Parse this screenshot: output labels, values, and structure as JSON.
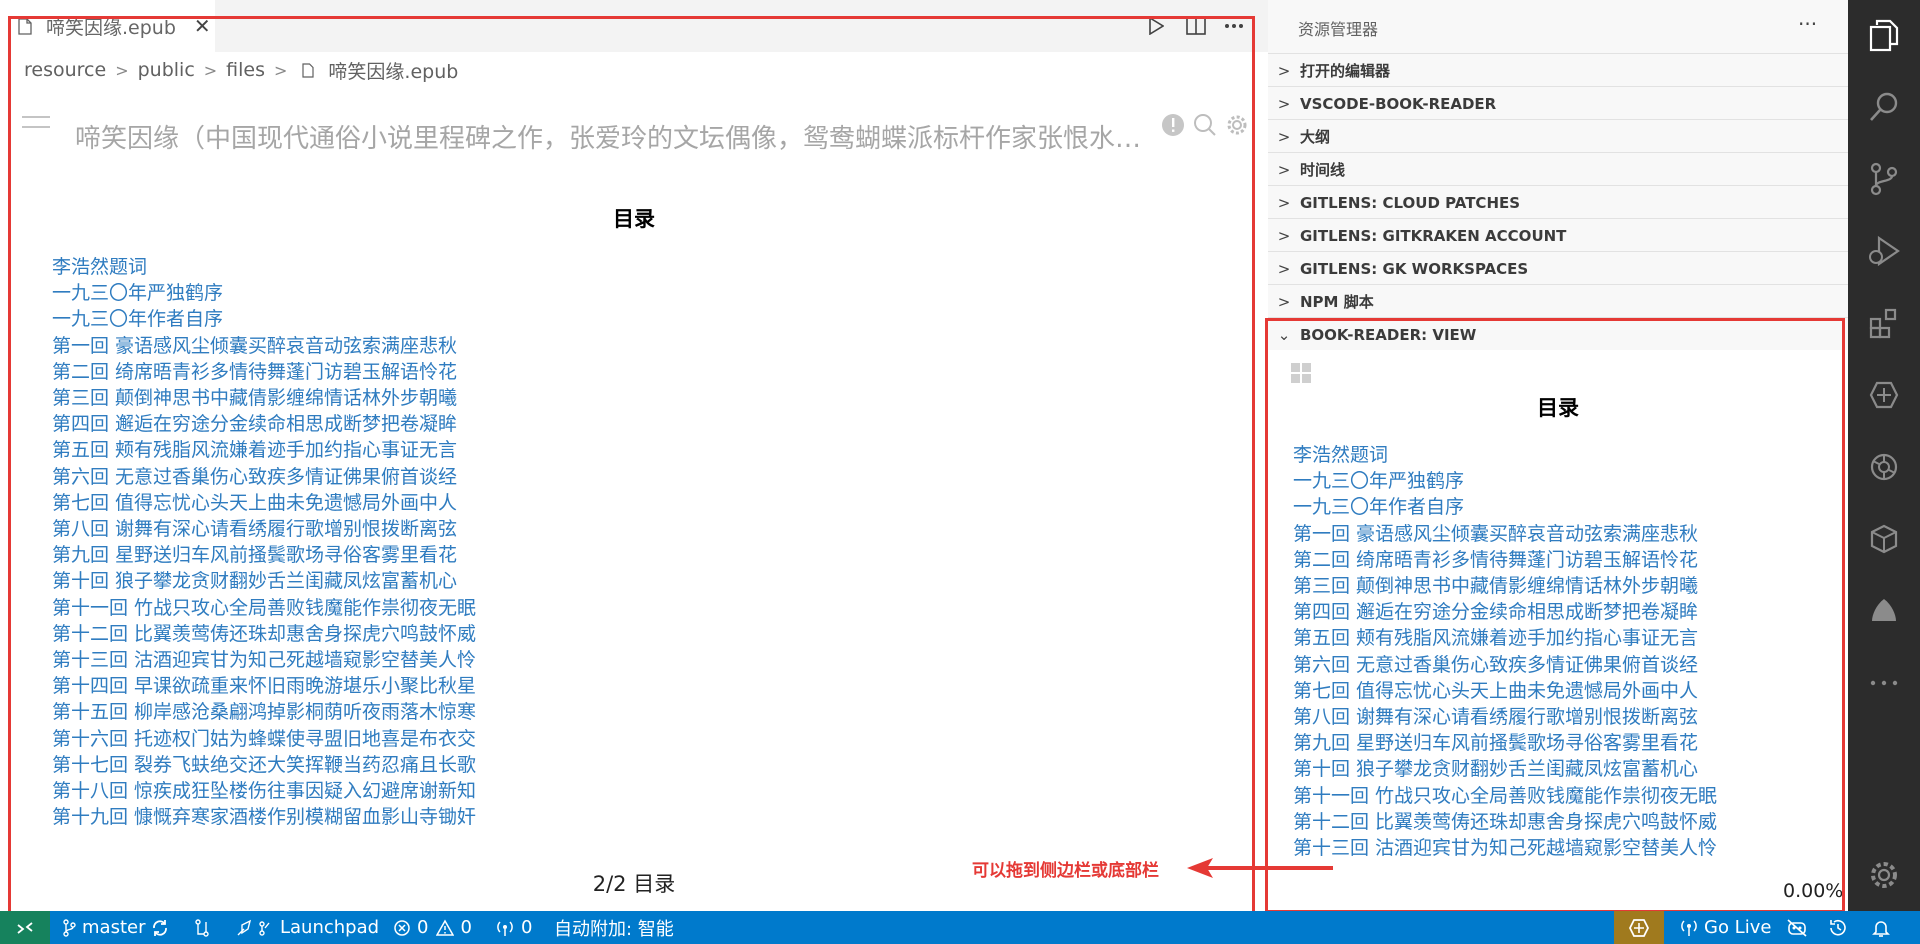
{
  "editor": {
    "tab": {
      "title": "啼笑因缘.epub",
      "close_glyph": "✕"
    },
    "actions": [
      "run-icon",
      "split-editor-icon",
      "more-actions-icon"
    ],
    "breadcrumb": [
      "resource",
      "public",
      "files",
      "啼笑因缘.epub"
    ],
    "book_title": "啼笑因缘（中国现代通俗小说里程碑之作，张爱玲的文坛偶像，鸳鸯蝴蝶派标杆作家张恨水…",
    "toc_title": "目录",
    "toc": [
      "李浩然题词",
      "一九三〇年严独鹤序",
      "一九三〇年作者自序",
      "第一回 豪语感风尘倾囊买醉哀音动弦索满座悲秋",
      "第二回 绮席晤青衫多情待舞蓬门访碧玉解语怜花",
      "第三回 颠倒神思书中藏倩影缠绵情话林外步朝曦",
      "第四回 邂逅在穷途分金续命相思成断梦把卷凝眸",
      "第五回 颊有残脂风流嫌着迹手加约指心事证无言",
      "第六回 无意过香巢伤心致疾多情证佛果俯首谈经",
      "第七回 值得忘忧心头天上曲未免遗憾局外画中人",
      "第八回 谢舞有深心请看绣履行歌增别恨拨断离弦",
      "第九回 星野送归车风前搔鬓歌场寻俗客雾里看花",
      "第十回 狼子攀龙贪财翻妙舌兰闺藏凤炫富蓄机心",
      "第十一回 竹战只攻心全局善败钱魔能作祟彻夜无眠",
      "第十二回 比翼羡莺俦还珠却惠舍身探虎穴鸣鼓怀威",
      "第十三回 沽酒迎宾甘为知己死越墙窥影空替美人怜",
      "第十四回 早课欲疏重来怀旧雨晚游堪乐小聚比秋星",
      "第十五回 柳岸感沧桑翩鸿掉影桐荫听夜雨落木惊寒",
      "第十六回 托迹权门姑为蜂蝶使寻盟旧地喜是布衣交",
      "第十七回 裂券飞蚨绝交还大笑挥鞭当药忍痛且长歌",
      "第十八回 惊疾成狂坠楼伤往事因疑入幻避席谢新知",
      "第十九回 慷慨弃寒家酒楼作别模糊留血影山寺锄奸"
    ],
    "page_info": "2/2 目录"
  },
  "sidebar": {
    "title": "资源管理器",
    "more_glyph": "···",
    "sections": [
      {
        "label": "打开的编辑器",
        "expanded": false
      },
      {
        "label": "VSCODE-BOOK-READER",
        "expanded": false
      },
      {
        "label": "大纲",
        "expanded": false
      },
      {
        "label": "时间线",
        "expanded": false
      },
      {
        "label": "GITLENS: CLOUD PATCHES",
        "expanded": false
      },
      {
        "label": "GITLENS: GITKRAKEN ACCOUNT",
        "expanded": false
      },
      {
        "label": "GITLENS: GK WORKSPACES",
        "expanded": false
      },
      {
        "label": "NPM 脚本",
        "expanded": false
      },
      {
        "label": "BOOK-READER: VIEW",
        "expanded": true
      }
    ],
    "view": {
      "toc_title": "目录",
      "toc": [
        "李浩然题词",
        "一九三〇年严独鹤序",
        "一九三〇年作者自序",
        "第一回 豪语感风尘倾囊买醉哀音动弦索满座悲秋",
        "第二回 绮席晤青衫多情待舞蓬门访碧玉解语怜花",
        "第三回 颠倒神思书中藏倩影缠绵情话林外步朝曦",
        "第四回 邂逅在穷途分金续命相思成断梦把卷凝眸",
        "第五回 颊有残脂风流嫌着迹手加约指心事证无言",
        "第六回 无意过香巢伤心致疾多情证佛果俯首谈经",
        "第七回 值得忘忧心头天上曲未免遗憾局外画中人",
        "第八回 谢舞有深心请看绣履行歌增别恨拨断离弦",
        "第九回 星野送归车风前搔鬓歌场寻俗客雾里看花",
        "第十回 狼子攀龙贪财翻妙舌兰闺藏凤炫富蓄机心",
        "第十一回 竹战只攻心全局善败钱魔能作祟彻夜无眠",
        "第十二回 比翼羡莺俦还珠却惠舍身探虎穴鸣鼓怀威",
        "第十三回 沽酒迎宾甘为知己死越墙窥影空替美人怜"
      ],
      "progress": "0.00%"
    }
  },
  "annotation": {
    "text": "可以拖到侧边栏或底部栏",
    "color": "#e53935"
  },
  "activity_bar": [
    "explorer-icon",
    "search-icon",
    "source-control-icon",
    "run-debug-icon",
    "extensions-icon",
    "gitlens-icon",
    "chatgpt-icon",
    "remote-explorer-icon",
    "gitkraken-icon",
    "more-icon",
    "settings-gear-icon"
  ],
  "status_bar": {
    "remote_glyph": "⚡",
    "branch": "master",
    "launchpad": "Launchpad",
    "errors": "0",
    "warnings": "0",
    "ports": "0",
    "auto_attach": "自动附加: 智能",
    "go_live": "Go Live"
  },
  "colors": {
    "accent": "#007acc",
    "remote": "#16825d",
    "link": "#2f7cc0",
    "highlight_box": "#e53935",
    "activity_bar": "#2c2c2c"
  }
}
